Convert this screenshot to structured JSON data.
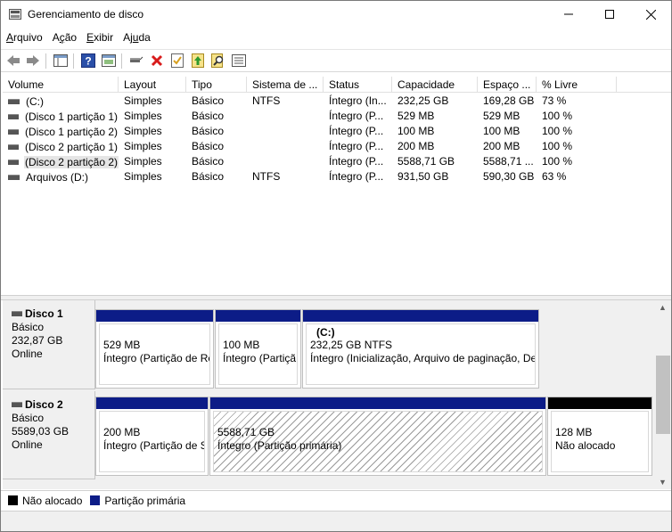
{
  "window": {
    "title": "Gerenciamento de disco"
  },
  "menu": [
    {
      "pre": "",
      "u": "A",
      "post": "rquivo"
    },
    {
      "pre": "A",
      "u": "ç",
      "post": "ão"
    },
    {
      "pre": "",
      "u": "E",
      "post": "xibir"
    },
    {
      "pre": "Aj",
      "u": "u",
      "post": "da"
    }
  ],
  "columns": [
    "Volume",
    "Layout",
    "Tipo",
    "Sistema de ...",
    "Status",
    "Capacidade",
    "Espaço ...",
    "% Livre"
  ],
  "volumes": [
    {
      "volume": "(C:)",
      "layout": "Simples",
      "tipo": "Básico",
      "fs": "NTFS",
      "status": "Íntegro (In...",
      "cap": "232,25 GB",
      "free": "169,28 GB",
      "pct": "73 %"
    },
    {
      "volume": "(Disco 1 partição 1)",
      "layout": "Simples",
      "tipo": "Básico",
      "fs": "",
      "status": "Íntegro (P...",
      "cap": "529 MB",
      "free": "529 MB",
      "pct": "100 %"
    },
    {
      "volume": "(Disco 1 partição 2)",
      "layout": "Simples",
      "tipo": "Básico",
      "fs": "",
      "status": "Íntegro (P...",
      "cap": "100 MB",
      "free": "100 MB",
      "pct": "100 %"
    },
    {
      "volume": "(Disco 2 partição 1)",
      "layout": "Simples",
      "tipo": "Básico",
      "fs": "",
      "status": "Íntegro (P...",
      "cap": "200 MB",
      "free": "200 MB",
      "pct": "100 %"
    },
    {
      "volume": "(Disco 2 partição 2)",
      "layout": "Simples",
      "tipo": "Básico",
      "fs": "",
      "status": "Íntegro (P...",
      "cap": "5588,71 GB",
      "free": "5588,71 ...",
      "pct": "100 %"
    },
    {
      "volume": "Arquivos (D:)",
      "layout": "Simples",
      "tipo": "Básico",
      "fs": "NTFS",
      "status": "Íntegro (P...",
      "cap": "931,50 GB",
      "free": "590,30 GB",
      "pct": "63 %"
    }
  ],
  "disks": [
    {
      "name": "Disco 1",
      "type": "Básico",
      "size": "232,87 GB",
      "state": "Online",
      "partitions": [
        {
          "name": "",
          "size": "529 MB",
          "status": "Íntegro (Partição de Re"
        },
        {
          "name": "",
          "size": "100 MB",
          "status": "Íntegro (Partiçã"
        },
        {
          "name": "(C:)",
          "size": "232,25 GB NTFS",
          "status": "Íntegro (Inicialização, Arquivo de paginação, De"
        }
      ]
    },
    {
      "name": "Disco 2",
      "type": "Básico",
      "size": "5589,03 GB",
      "state": "Online",
      "partitions": [
        {
          "name": "",
          "size": "200 MB",
          "status": "Íntegro (Partição de S"
        },
        {
          "name": "",
          "size": "5588,71 GB",
          "status": "Íntegro (Partição primária)"
        },
        {
          "name": "",
          "size": "128 MB",
          "status": "Não alocado"
        }
      ]
    }
  ],
  "legend": [
    {
      "label": "Não alocado",
      "color": "#000000"
    },
    {
      "label": "Partição primária",
      "color": "#0c1c87"
    }
  ],
  "colors": {
    "primary_partition": "#0c1c87",
    "unallocated": "#000000"
  },
  "toolbar_icons": [
    "back-icon",
    "forward-icon",
    "console-tree-icon",
    "help-icon",
    "view-icon",
    "connect-icon",
    "delete-icon",
    "properties-icon",
    "refresh-icon",
    "find-icon",
    "export-list-icon"
  ]
}
